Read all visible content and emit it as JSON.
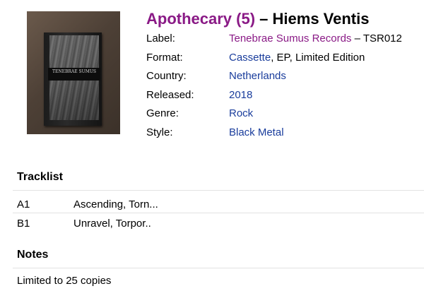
{
  "release": {
    "artist": "Apothecary (5)",
    "separator": " – ",
    "title": "Hiems Ventis"
  },
  "cover": {
    "band_text": "TENEBRAE SUMUS"
  },
  "props": {
    "label_key": "Label:",
    "label_name": "Tenebrae Sumus Records",
    "label_cat": " – TSR012",
    "format_key": "Format:",
    "format_link": "Cassette",
    "format_rest": ", EP, Limited Edition",
    "country_key": "Country:",
    "country": "Netherlands",
    "released_key": "Released:",
    "released": "2018",
    "genre_key": "Genre:",
    "genre": "Rock",
    "style_key": "Style:",
    "style": "Black Metal"
  },
  "tracklist": {
    "heading": "Tracklist",
    "tracks": [
      {
        "pos": "A1",
        "title": "Ascending, Torn..."
      },
      {
        "pos": "B1",
        "title": "Unravel, Torpor.."
      }
    ]
  },
  "notes": {
    "heading": "Notes",
    "text": "Limited to 25 copies"
  },
  "colors": {
    "artist_link": "#8a1a86",
    "link": "#1a3d9c"
  }
}
